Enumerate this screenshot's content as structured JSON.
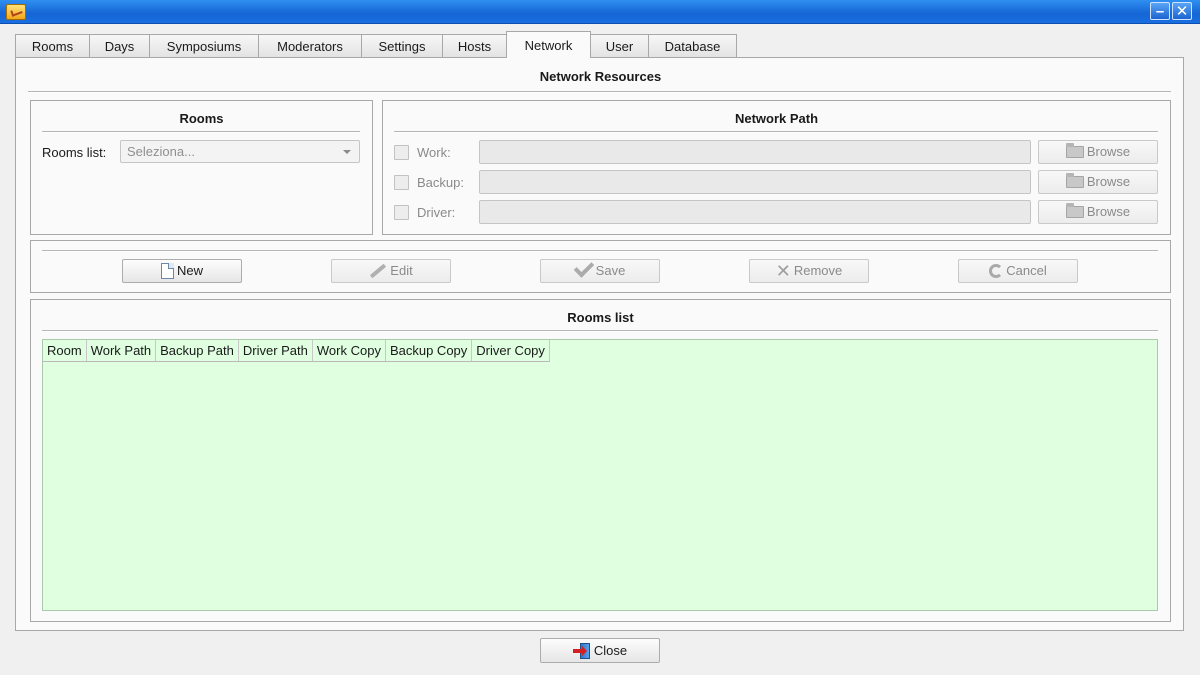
{
  "window": {
    "minimize_glyph": "–",
    "close_glyph": "✕"
  },
  "tabs": [
    {
      "label": "Rooms"
    },
    {
      "label": "Days"
    },
    {
      "label": "Symposiums"
    },
    {
      "label": "Moderators"
    },
    {
      "label": "Settings"
    },
    {
      "label": "Hosts"
    },
    {
      "label": "Network",
      "active": true
    },
    {
      "label": "User"
    },
    {
      "label": "Database"
    }
  ],
  "main": {
    "title": "Network Resources",
    "rooms_group": {
      "title": "Rooms",
      "rooms_list_label": "Rooms list:",
      "rooms_select_value": "Seleziona..."
    },
    "network_group": {
      "title": "Network Path",
      "rows": [
        {
          "label": "Work:",
          "browse": "Browse",
          "value": ""
        },
        {
          "label": "Backup:",
          "browse": "Browse",
          "value": ""
        },
        {
          "label": "Driver:",
          "browse": "Browse",
          "value": ""
        }
      ]
    },
    "toolbar": {
      "new": "New",
      "edit": "Edit",
      "save": "Save",
      "remove": "Remove",
      "cancel": "Cancel"
    },
    "list_group": {
      "title": "Rooms list",
      "columns": [
        "Room",
        "Work Path",
        "Backup Path",
        "Driver Path",
        "Work Copy",
        "Backup Copy",
        "Driver Copy"
      ],
      "rows": []
    }
  },
  "footer": {
    "close": "Close"
  },
  "colors": {
    "titlebar": "#1565d6",
    "grid_background": "#dfffe0",
    "panel_background": "#fafafa"
  }
}
